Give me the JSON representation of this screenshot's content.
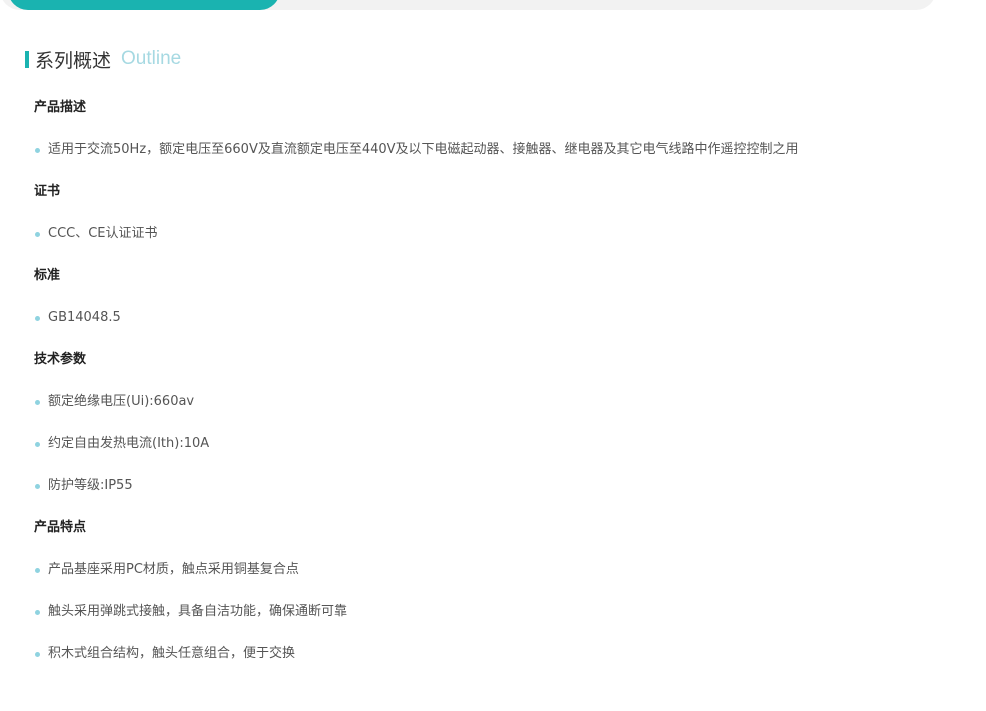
{
  "section": {
    "title": "系列概述",
    "subtitle": "Outline"
  },
  "groups": [
    {
      "title": "产品描述",
      "items": [
        "适用于交流50Hz，额定电压至660V及直流额定电压至440V及以下电磁起动器、接触器、继电器及其它电气线路中作遥控控制之用"
      ]
    },
    {
      "title": "证书",
      "items": [
        "CCC、CE认证证书"
      ]
    },
    {
      "title": "标准",
      "items": [
        "GB14048.5"
      ]
    },
    {
      "title": "技术参数",
      "items": [
        "额定绝缘电压(Ui):660av",
        "约定自由发热电流(Ith):10A",
        "防护等级:IP55"
      ]
    },
    {
      "title": "产品特点",
      "items": [
        "产品基座采用PC材质，触点采用铜基复合点",
        "触头采用弹跳式接触，具备自洁功能，确保通断可靠",
        "积木式组合结构，触头任意组合，便于交换"
      ]
    }
  ],
  "colors": {
    "accent": "#1ab3b0",
    "subtitle": "#a6d9e2",
    "bullet": "#8fd3e0"
  }
}
